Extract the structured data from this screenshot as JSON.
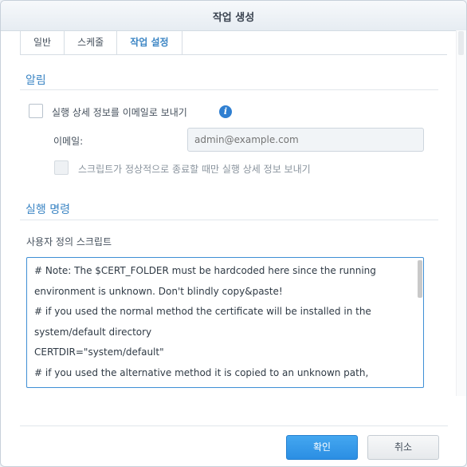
{
  "dialog": {
    "title": "작업 생성"
  },
  "tabs": [
    {
      "label": "일반"
    },
    {
      "label": "스케줄"
    },
    {
      "label": "작업 설정",
      "active": true
    }
  ],
  "notification": {
    "section_title": "알림",
    "send_details_label": "실행 상세 정보를 이메일로 보내기",
    "send_details_checked": false,
    "email_label": "이메일:",
    "email_placeholder": "admin@example.com",
    "email_value": "",
    "only_abnormal_label": "스크립트가 정상적으로 종료할 때만 실행 상세 정보 보내기",
    "only_abnormal_checked": false
  },
  "run_command": {
    "section_title": "실행 명령",
    "script_label": "사용자 정의 스크립트",
    "script_lines": [
      "# Note: The $CERT_FOLDER must be hardcoded here since the running",
      "environment is unknown. Don't blindly copy&paste!",
      "# if you used the normal method the certificate will be installed in the",
      "system/default directory",
      "CERTDIR=\"system/default\"",
      "# if you used the alternative method it is copied to an unknown path,"
    ]
  },
  "buttons": {
    "ok_label": "확인",
    "cancel_label": "취소"
  },
  "colors": {
    "accent": "#3b85c4",
    "primary_button": "#2b8ee3",
    "focus_border": "#3f8fd5"
  }
}
